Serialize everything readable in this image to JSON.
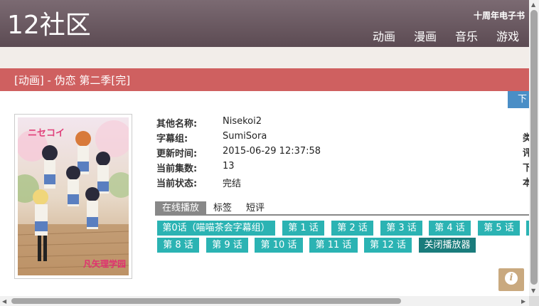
{
  "header": {
    "logo": "12社区",
    "tagline": "十周年电子书",
    "nav": [
      "动画",
      "漫画",
      "音乐",
      "游戏"
    ]
  },
  "title_bar": "[动画] - 伪恋 第二季[完]",
  "download_button": "下",
  "info": {
    "rows": [
      {
        "label": "其他名称:",
        "value": "Nisekoi2"
      },
      {
        "label": "字幕组:",
        "value": "SumiSora"
      },
      {
        "label": "更新时间:",
        "value": "2015-06-29 12:37:58"
      },
      {
        "label": "当前集数:",
        "value": "13"
      },
      {
        "label": "当前状态:",
        "value": "完结"
      }
    ],
    "right_column": [
      "类",
      "评",
      "下",
      "本"
    ]
  },
  "tabs": [
    "在线播放",
    "标签",
    "短评"
  ],
  "episodes": [
    "第0话（喵喵茶会字幕组）",
    "第 1 话",
    "第 2 话",
    "第 3 话",
    "第 4 话",
    "第 5 话",
    "",
    "第 8 话",
    "第 9 话",
    "第 10 话",
    "第 11 话",
    "第 12 话",
    "关闭播放器"
  ],
  "poster_text": {
    "logo": "ニセコイ",
    "school": "凡矢理学园"
  },
  "colors": {
    "header": "#6b5961",
    "title_bar": "#cf6060",
    "episode": "#2bb3b3",
    "close_button": "#1a7c7c",
    "download": "#4a8ec6"
  },
  "icons": {
    "info": "info-icon"
  }
}
